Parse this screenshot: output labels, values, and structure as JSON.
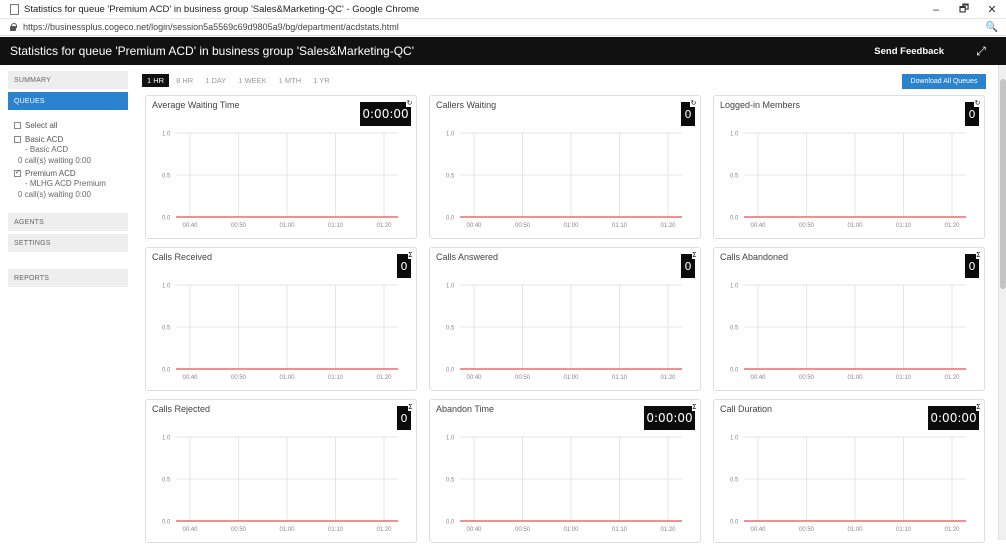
{
  "browser": {
    "window_title": "Statistics for queue 'Premium ACD' in business group 'Sales&Marketing-QC' - Google Chrome",
    "url": "https://businessplus.cogeco.net/login/session5a5569c69d9805a9/bg/department/acdstats.html",
    "controls": {
      "minimize": "–",
      "restore": "🗗",
      "close": "✕"
    }
  },
  "header": {
    "title": "Statistics for queue 'Premium ACD' in business group 'Sales&Marketing-QC'",
    "feedback_label": "Send Feedback"
  },
  "sidebar": {
    "summary_label": "SUMMARY",
    "queues_label": "QUEUES",
    "select_all_label": "Select all",
    "queues": [
      {
        "name": "Basic ACD",
        "sub": "- Basic ACD",
        "waiting": "0 call(s) waiting 0:00",
        "checked": false
      },
      {
        "name": "Premium ACD",
        "sub": "- MLHG ACD Premium",
        "waiting": "0 call(s) waiting 0:00",
        "checked": true
      }
    ],
    "agents_label": "AGENTS",
    "settings_label": "SETTINGS",
    "reports_label": "REPORTS"
  },
  "time_ranges": [
    "1 HR",
    "8 HR",
    "1 DAY",
    "1 WEEK",
    "1 MTH",
    "1 YR"
  ],
  "active_range": "1 HR",
  "download_label": "Download All Queues",
  "panels": [
    {
      "title": "Average Waiting Time",
      "value": "0:00:00",
      "marker": "↻"
    },
    {
      "title": "Callers Waiting",
      "value": "0",
      "marker": "↻"
    },
    {
      "title": "Logged-in Members",
      "value": "0",
      "marker": "↻"
    },
    {
      "title": "Calls Received",
      "value": "0",
      "marker": "Σ"
    },
    {
      "title": "Calls Answered",
      "value": "0",
      "marker": "Σ"
    },
    {
      "title": "Calls Abandoned",
      "value": "0",
      "marker": "Σ"
    },
    {
      "title": "Calls Rejected",
      "value": "0",
      "marker": "Σ"
    },
    {
      "title": "Abandon Time",
      "value": "0:00:00",
      "marker": "Σ"
    },
    {
      "title": "Call Duration",
      "value": "0:00:00",
      "marker": "Σ"
    }
  ],
  "chart_data": {
    "type": "line",
    "x": [
      "00:40",
      "00:50",
      "01:00",
      "01:10",
      "01:20"
    ],
    "y_ticks": [
      "1.0",
      "0.5",
      "0.0"
    ],
    "ylim": [
      0,
      1
    ],
    "series": [
      {
        "values": [
          0,
          0,
          0,
          0,
          0
        ],
        "color": "#d9534f"
      }
    ]
  }
}
